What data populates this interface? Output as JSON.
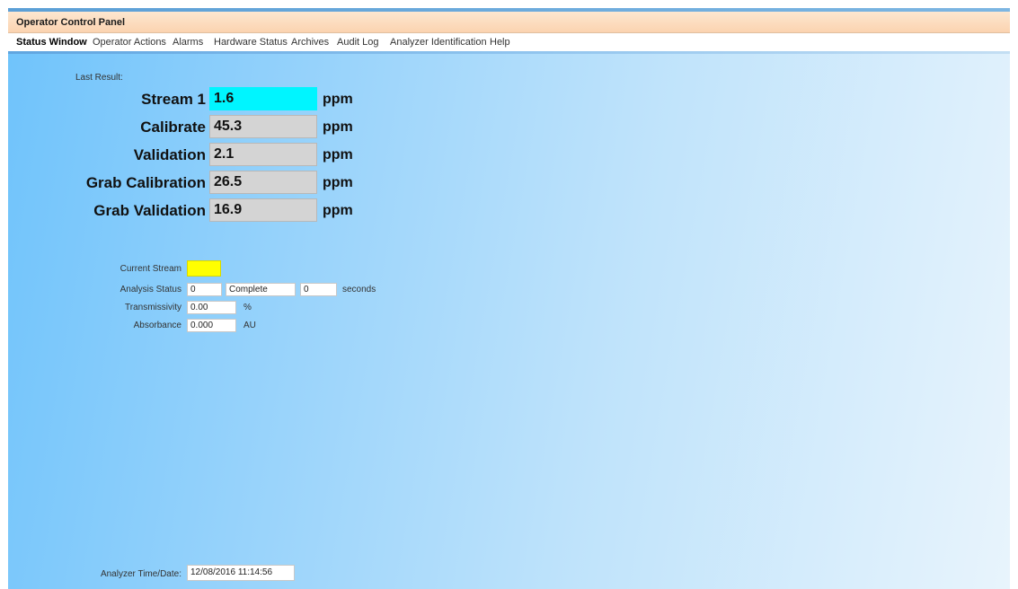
{
  "window": {
    "title": "Operator Control Panel"
  },
  "menu": {
    "items": [
      {
        "label": "Status Window",
        "active": true
      },
      {
        "label": "Operator Actions"
      },
      {
        "label": "Alarms"
      },
      {
        "label": "Hardware Status"
      },
      {
        "label": "Archives"
      },
      {
        "label": "Audit Log"
      },
      {
        "label": "Analyzer Identification"
      },
      {
        "label": "Help"
      }
    ]
  },
  "last_result": {
    "label": "Last Result:",
    "rows": [
      {
        "label": "Stream 1",
        "value": "1.6",
        "unit": "ppm"
      },
      {
        "label": "Calibrate",
        "value": "45.3",
        "unit": "ppm"
      },
      {
        "label": "Validation",
        "value": "2.1",
        "unit": "ppm"
      },
      {
        "label": "Grab Calibration",
        "value": "26.5",
        "unit": "ppm"
      },
      {
        "label": "Grab Validation",
        "value": "16.9",
        "unit": "ppm"
      }
    ]
  },
  "status": {
    "current_stream_label": "Current Stream",
    "current_stream_color": "#ffff00",
    "analysis_status_label": "Analysis Status",
    "analysis_status_code": "0",
    "analysis_status_text": "Complete",
    "analysis_seconds": "0",
    "seconds_unit": "seconds",
    "transmissivity_label": "Transmissivity",
    "transmissivity_value": "0.00",
    "transmissivity_unit": "%",
    "absorbance_label": "Absorbance",
    "absorbance_value": "0.000",
    "absorbance_unit": "AU"
  },
  "footer": {
    "time_label": "Analyzer Time/Date:",
    "time_value": "12/08/2016 11:14:56"
  },
  "colors": {
    "active_result": "#00f5ff",
    "inactive_result": "#d4d4d4",
    "title_bar": "#fbd3b0"
  }
}
